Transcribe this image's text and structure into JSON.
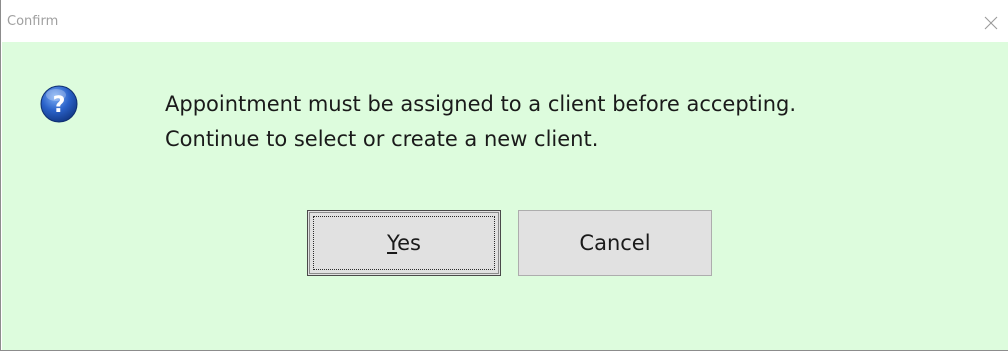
{
  "window": {
    "title": "Confirm",
    "close_icon": "close-icon"
  },
  "dialog": {
    "icon": "question-icon",
    "message_lines": [
      "Appointment must be assigned to a client before accepting.",
      "Continue to select or create a new client."
    ],
    "background_color": "#ddfcdd"
  },
  "buttons": {
    "yes": {
      "mnemonic": "Y",
      "rest": "es",
      "label": "Yes"
    },
    "cancel": {
      "label": "Cancel"
    }
  }
}
